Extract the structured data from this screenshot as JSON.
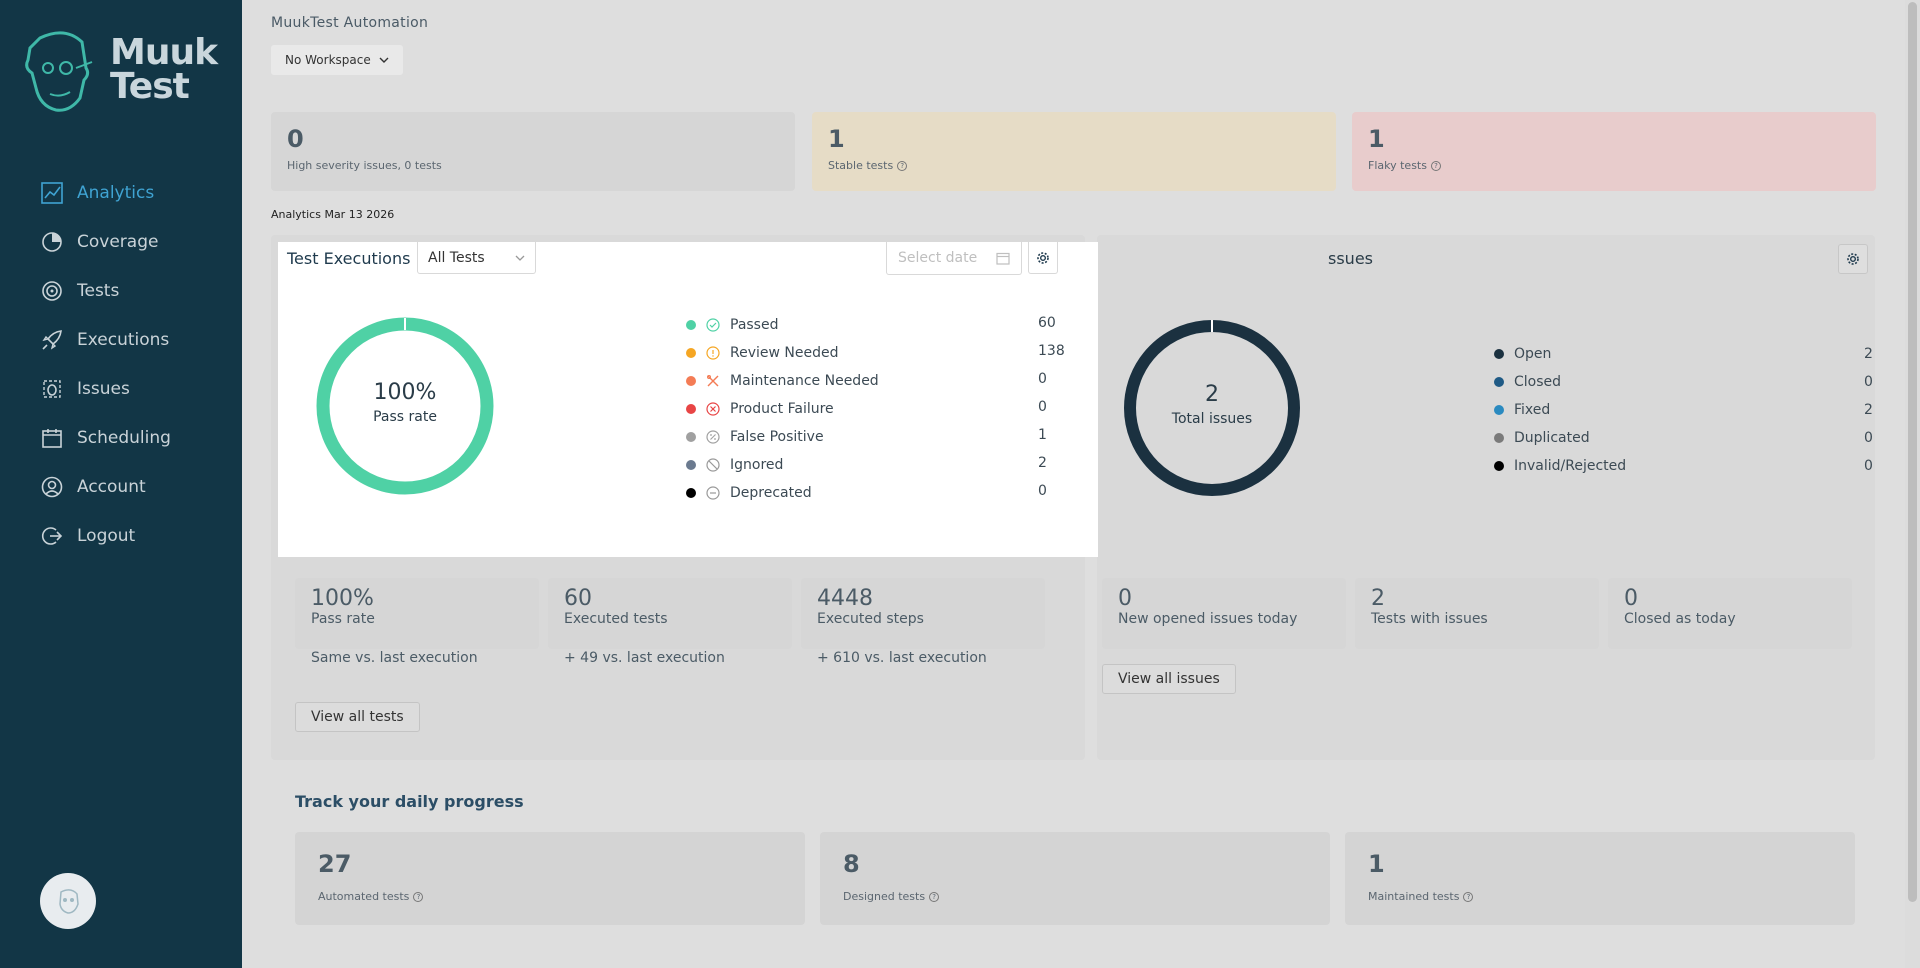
{
  "sidebar": {
    "logo_text_line1": "Muuk",
    "logo_text_line2": "Test",
    "items": [
      {
        "label": "Analytics",
        "icon": "chart-line-icon",
        "active": true
      },
      {
        "label": "Coverage",
        "icon": "pie-chart-icon",
        "active": false
      },
      {
        "label": "Tests",
        "icon": "target-icon",
        "active": false
      },
      {
        "label": "Executions",
        "icon": "rocket-icon",
        "active": false
      },
      {
        "label": "Issues",
        "icon": "bug-icon",
        "active": false
      },
      {
        "label": "Scheduling",
        "icon": "calendar-icon",
        "active": false
      },
      {
        "label": "Account",
        "icon": "user-circle-icon",
        "active": false
      },
      {
        "label": "Logout",
        "icon": "logout-icon",
        "active": false
      }
    ]
  },
  "header": {
    "app_title": "MuukTest Automation",
    "workspace": "No Workspace"
  },
  "top_stats": [
    {
      "value": "0",
      "caption": "High severity issues, 0 tests",
      "bg": "#d6d6d6"
    },
    {
      "value": "1",
      "caption": "Stable tests",
      "bg": "#e6dcc6"
    },
    {
      "value": "1",
      "caption": "Flaky tests",
      "bg": "#e8cccc"
    }
  ],
  "analytics_date": "Analytics Mar 13 2026",
  "issues_panel": {
    "title_partial": "ssues",
    "donut_value": "2",
    "donut_label": "Total issues",
    "legend": [
      {
        "label": "Open",
        "value": "2",
        "color": "#1b3140"
      },
      {
        "label": "Closed",
        "value": "0",
        "color": "#1f5a85"
      },
      {
        "label": "Fixed",
        "value": "2",
        "color": "#2a8ac0"
      },
      {
        "label": "Duplicated",
        "value": "0",
        "color": "#7a7a7a"
      },
      {
        "label": "Invalid/Rejected",
        "value": "0",
        "color": "#000000"
      }
    ]
  },
  "test_metrics": [
    {
      "value": "100%",
      "label": "Pass rate",
      "sub": "Same vs. last execution"
    },
    {
      "value": "60",
      "label": "Executed tests",
      "sub": "+ 49 vs. last execution"
    },
    {
      "value": "4448",
      "label": "Executed steps",
      "sub": "+ 610 vs. last execution"
    }
  ],
  "issue_metrics": [
    {
      "value": "0",
      "label": "New opened issues today"
    },
    {
      "value": "2",
      "label": "Tests with issues"
    },
    {
      "value": "0",
      "label": "Closed as today"
    }
  ],
  "buttons": {
    "view_all_tests": "View all tests",
    "view_all_issues": "View all issues"
  },
  "progress": {
    "title": "Track your daily progress",
    "cards": [
      {
        "value": "27",
        "caption": "Automated tests"
      },
      {
        "value": "8",
        "caption": "Designed tests"
      },
      {
        "value": "1",
        "caption": "Maintained tests"
      }
    ]
  },
  "modal": {
    "title": "Test Executions",
    "filter_value": "All Tests",
    "date_placeholder": "Select date",
    "donut_value": "100%",
    "donut_label": "Pass rate",
    "donut_color": "#4fd1a5",
    "legend": [
      {
        "label": "Passed",
        "value": "60",
        "color": "#4fd1a5",
        "icon": "check-circle-icon"
      },
      {
        "label": "Review Needed",
        "value": "138",
        "color": "#f5a623",
        "icon": "alert-circle-icon"
      },
      {
        "label": "Maintenance Needed",
        "value": "0",
        "color": "#f47c55",
        "icon": "tools-icon"
      },
      {
        "label": "Product Failure",
        "value": "0",
        "color": "#e84545",
        "icon": "x-circle-icon"
      },
      {
        "label": "False Positive",
        "value": "1",
        "color": "#a0a0a0",
        "icon": "percent-circle-icon"
      },
      {
        "label": "Ignored",
        "value": "2",
        "color": "#6b7a8f",
        "icon": "ban-icon"
      },
      {
        "label": "Deprecated",
        "value": "0",
        "color": "#000000",
        "icon": "minus-circle-icon"
      }
    ]
  }
}
